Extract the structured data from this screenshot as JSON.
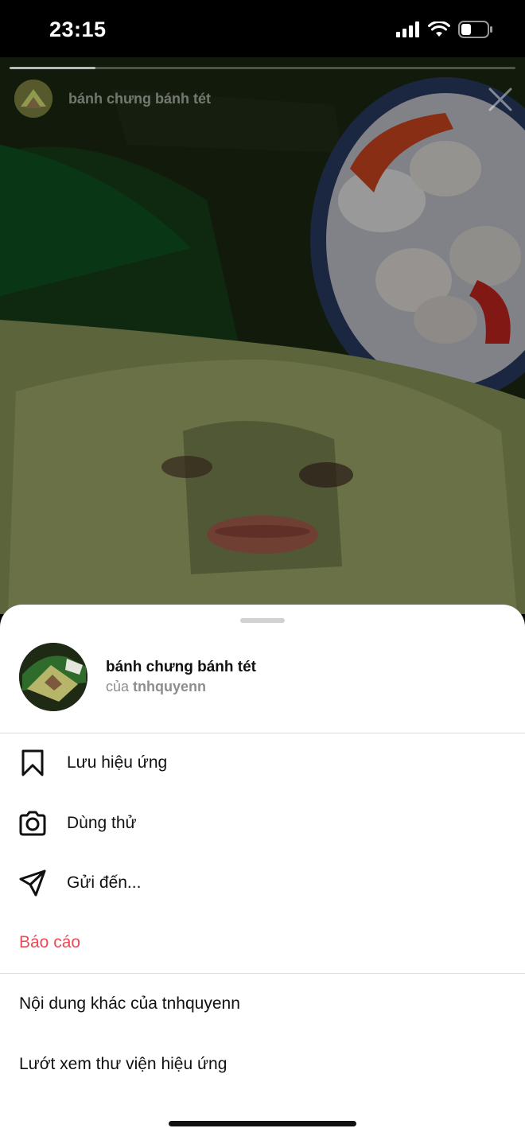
{
  "status_bar": {
    "time": "23:15",
    "battery_level": 0.4
  },
  "story": {
    "progress": 0.17,
    "title": "bánh chưng bánh tét"
  },
  "sheet": {
    "effect": {
      "name": "bánh chưng bánh tét",
      "by_prefix": "của",
      "author": "tnhquyenn"
    },
    "menu": [
      {
        "label": "Lưu hiệu ứng",
        "icon": "bookmark-icon"
      },
      {
        "label": "Dùng thử",
        "icon": "camera-icon"
      },
      {
        "label": "Gửi đến...",
        "icon": "send-icon"
      },
      {
        "label": "Báo cáo",
        "style": "danger"
      }
    ],
    "more": [
      {
        "label": "Nội dung khác của tnhquyenn"
      },
      {
        "label": "Lướt xem thư viện hiệu ứng"
      }
    ]
  },
  "colors": {
    "danger": "#ed4956",
    "secondary_text": "#8e8e8e",
    "divider": "#dbdbdb"
  }
}
